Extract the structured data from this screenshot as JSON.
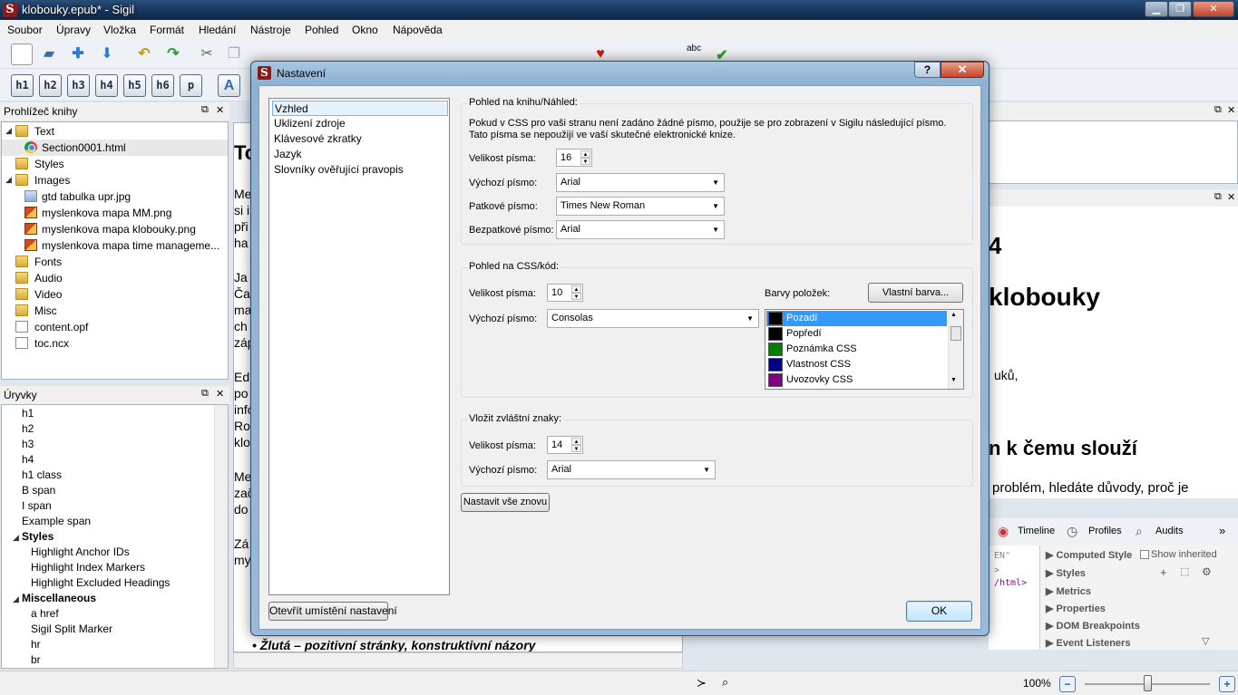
{
  "window": {
    "title": "klobouky.epub* - Sigil",
    "app_icon": "S"
  },
  "window_controls": {
    "minimize": "▁",
    "maximize": "❐",
    "close": "✕"
  },
  "menu": [
    "Soubor",
    "Úpravy",
    "Vložka",
    "Formát",
    "Hledání",
    "Nástroje",
    "Pohled",
    "Okno",
    "Nápověda"
  ],
  "heading_buttons": [
    "h1",
    "h2",
    "h3",
    "h4",
    "h5",
    "h6",
    "p"
  ],
  "toolbar_misc": {
    "spell_label": "abc"
  },
  "book_browser": {
    "title": "Prohlížeč knihy",
    "items": [
      {
        "label": "Text",
        "icon": "folder-icon"
      },
      {
        "label": "Section0001.html",
        "icon": "chrome-icon"
      },
      {
        "label": "Styles",
        "icon": "folder-icon"
      },
      {
        "label": "Images",
        "icon": "folder-icon"
      },
      {
        "label": "gtd tabulka upr.jpg",
        "icon": "image-icon"
      },
      {
        "label": "myslenkova mapa MM.png",
        "icon": "image-icon"
      },
      {
        "label": "myslenkova mapa klobouky.png",
        "icon": "image-icon"
      },
      {
        "label": "myslenkova mapa time manageme...",
        "icon": "image-icon"
      },
      {
        "label": "Fonts",
        "icon": "folder-icon"
      },
      {
        "label": "Audio",
        "icon": "folder-icon"
      },
      {
        "label": "Video",
        "icon": "folder-icon"
      },
      {
        "label": "Misc",
        "icon": "folder-icon"
      },
      {
        "label": "content.opf",
        "icon": "file-icon"
      },
      {
        "label": "toc.ncx",
        "icon": "file-icon"
      }
    ]
  },
  "clips": {
    "title": "Úryvky",
    "items": [
      "h1",
      "h2",
      "h3",
      "h4",
      "h1 class",
      "B span",
      "I span",
      "Example span",
      "Styles",
      "Highlight Anchor IDs",
      "Highlight Index Markers",
      "Highlight Excluded Headings",
      "Miscellaneous",
      "a href",
      "Sigil Split Marker",
      "hr",
      "br"
    ]
  },
  "editor": {
    "lines": [
      "To",
      "Me",
      "si i",
      "při",
      "ha",
      "Ja",
      "Ča",
      "ma",
      "ch",
      "záp",
      "Ed",
      "po",
      "info",
      " Ro",
      "klo",
      "Me",
      "zač",
      "do",
      "Zá",
      "my"
    ],
    "bottom_line": "Žlutá – pozitivní stránky, konstruktivní názory"
  },
  "preview": {
    "lines": [
      "4",
      "klobouky",
      "uků,",
      "n k čemu slouží",
      "problém, hledáte důvody, proč je"
    ]
  },
  "inspector": {
    "tabs": [
      "Timeline",
      "Profiles",
      "Audits"
    ],
    "code": [
      "EN\"",
      ">",
      "/html>"
    ],
    "sections": [
      "Computed Style",
      "Styles",
      "Metrics",
      "Properties",
      "DOM Breakpoints",
      "Event Listeners"
    ],
    "show_inherited": "Show inherited"
  },
  "status": {
    "zoom": "100%"
  },
  "dialog": {
    "title": "Nastavení",
    "help": "?",
    "close": "✕",
    "nav": [
      "Vzhled",
      "Uklizení zdroje",
      "Klávesové zkratky",
      "Jazyk",
      "Slovníky ověřující pravopis"
    ],
    "open_location": "Otevřít umístění nastavení",
    "ok": "OK",
    "reset": "Nastavit vše znovu",
    "book_view": {
      "title": "Pohled na knihu/Náhled:",
      "info": "Pokud v CSS pro vaši stranu není zadáno žádné písmo, použije se pro zobrazení v Sigilu následující písmo. Tato písma se nepoužijí ve vaší skutečné elektronické knize.",
      "size_label": "Velikost písma:",
      "size": "16",
      "default_label": "Výchozí písmo:",
      "default": "Arial",
      "serif_label": "Patkové písmo:",
      "serif": "Times New Roman",
      "sans_label": "Bezpatkové písmo:",
      "sans": "Arial"
    },
    "css_view": {
      "title": "Pohled na CSS/kód:",
      "size_label": "Velikost písma:",
      "size": "10",
      "default_label": "Výchozí písmo:",
      "default": "Consolas",
      "colors_label": "Barvy položek:",
      "custom_color": "Vlastní barva...",
      "colors": [
        {
          "name": "Pozadí",
          "color": "#000000"
        },
        {
          "name": "Popředí",
          "color": "#000000"
        },
        {
          "name": "Poznámka CSS",
          "color": "#008000"
        },
        {
          "name": "Vlastnost CSS",
          "color": "#000080"
        },
        {
          "name": "Uvozovky CSS",
          "color": "#800080"
        }
      ]
    },
    "special_chars": {
      "title": "Vložit zvláštní znaky:",
      "size_label": "Velikost písma:",
      "size": "14",
      "default_label": "Výchozí písmo:",
      "default": "Arial"
    }
  }
}
